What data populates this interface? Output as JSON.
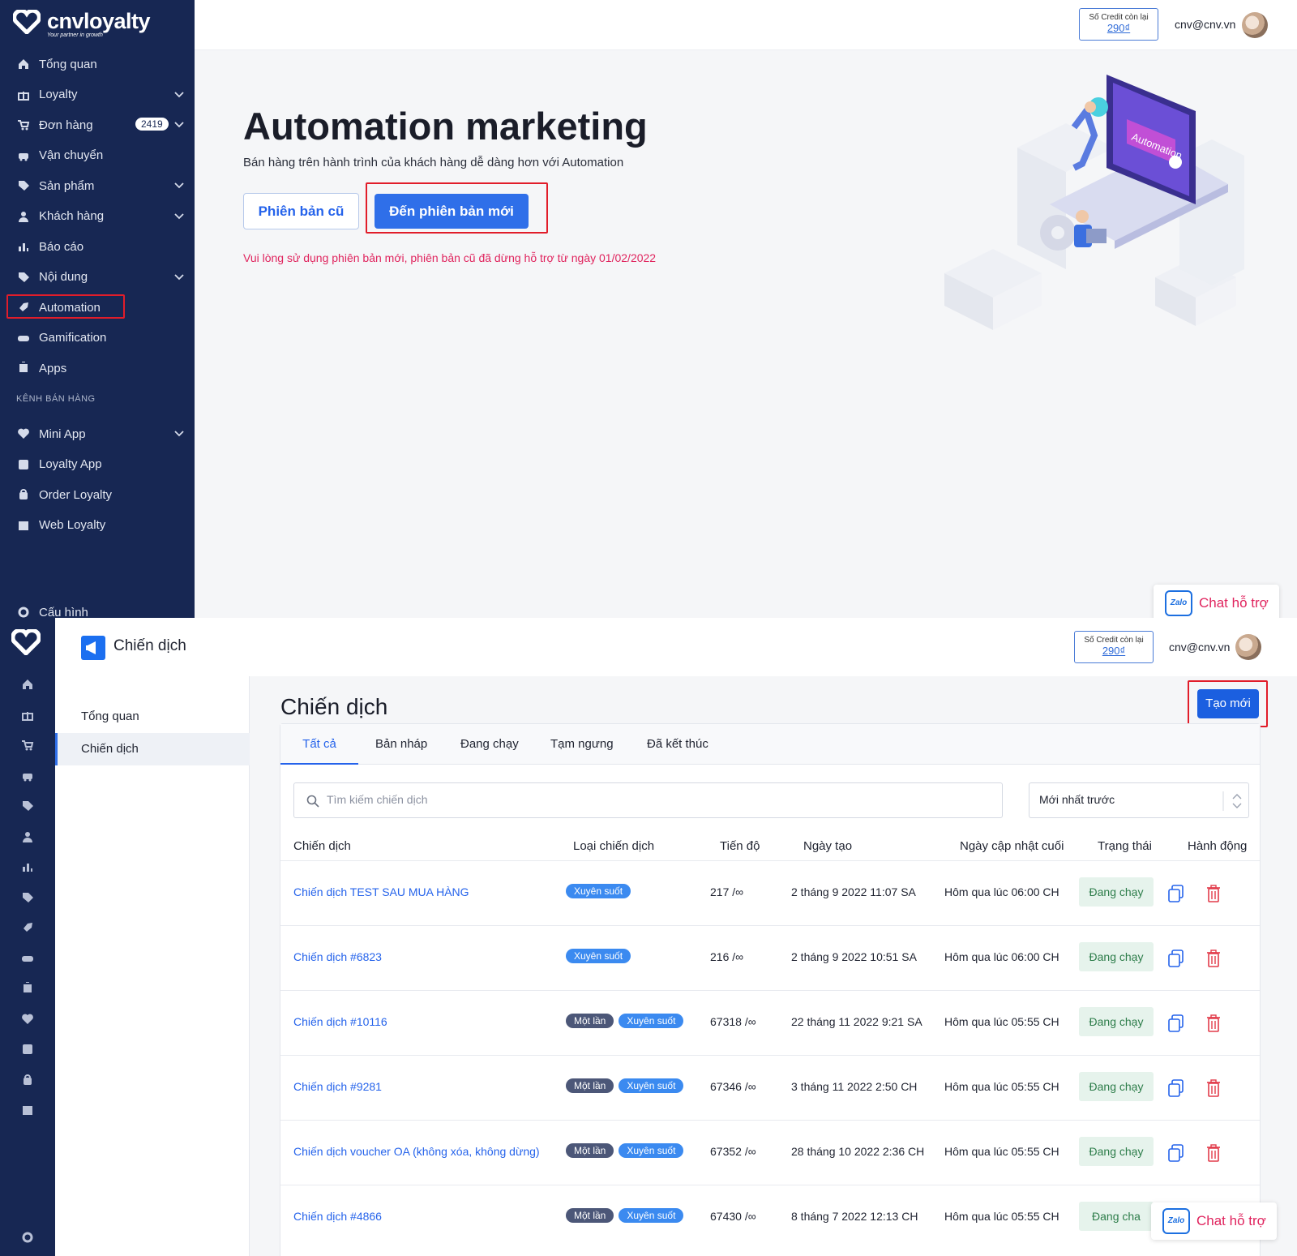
{
  "colors": {
    "sidebar": "#172753",
    "primary": "#2f6fe9",
    "highlight_box": "#e11d2a",
    "warning": "#e0245e"
  },
  "top": {
    "brand": "cnvloyalty",
    "tagline": "Your partner in growth",
    "nav": [
      {
        "label": "Tổng quan",
        "icon": "home-icon"
      },
      {
        "label": "Loyalty",
        "icon": "gift-icon"
      },
      {
        "label": "Đơn hàng",
        "icon": "cart-icon",
        "badge": "2419"
      },
      {
        "label": "Vận chuyển",
        "icon": "car-icon"
      },
      {
        "label": "Sản phẩm",
        "icon": "tag-icon"
      },
      {
        "label": "Khách hàng",
        "icon": "user-icon"
      },
      {
        "label": "Báo cáo",
        "icon": "chart-icon"
      },
      {
        "label": "Nội dung",
        "icon": "tag-icon"
      },
      {
        "label": "Automation",
        "icon": "rocket-icon"
      },
      {
        "label": "Gamification",
        "icon": "gamepad-icon"
      },
      {
        "label": "Apps",
        "icon": "puzzle-icon"
      }
    ],
    "section_label": "KÊNH BÁN HÀNG",
    "channels": [
      {
        "label": "Mini App",
        "icon": "heart-icon"
      },
      {
        "label": "Loyalty App",
        "icon": "app-store-icon"
      },
      {
        "label": "Order Loyalty",
        "icon": "bag-icon"
      },
      {
        "label": "Web Loyalty",
        "icon": "store-icon"
      }
    ],
    "settings": "Cấu hình",
    "credit_label": "Số Credit còn lại",
    "credit_value": "290₫",
    "email": "cnv@cnv.vn",
    "title": "Automation marketing",
    "subtitle": "Bán hàng trên hành trình của khách hàng dễ dàng hơn với Automation",
    "old_version_btn": "Phiên bản cũ",
    "new_version_btn": "Đến phiên bản mới",
    "warning": "Vui lòng sử dụng phiên bản mới, phiên bản cũ đã dừng hỗ trợ từ ngày 01/02/2022",
    "illustration_text": "Automation",
    "chat_label": "Chat hỗ trợ",
    "zalo": "Zalo"
  },
  "bottom": {
    "header_title": "Chiến dịch",
    "credit_label": "Số Credit còn lại",
    "credit_value": "290₫",
    "email": "cnv@cnv.vn",
    "left_menu": [
      "Tổng quan",
      "Chiến dịch"
    ],
    "page_title": "Chiến dịch",
    "create_btn": "Tạo mới",
    "tabs": [
      "Tất cả",
      "Bản nháp",
      "Đang chạy",
      "Tạm ngưng",
      "Đã kết thúc"
    ],
    "search_placeholder": "Tìm kiếm chiến dịch",
    "sort_value": "Mới nhất trước",
    "columns": [
      "Chiến dịch",
      "Loại chiến dịch",
      "Tiến độ",
      "Ngày tạo",
      "Ngày cập nhật cuối",
      "Trạng thái",
      "Hành động"
    ],
    "rows": [
      {
        "name": "Chiến dịch TEST SAU MUA HÀNG",
        "types": [
          "Xuyên suốt"
        ],
        "progress": "217 /∞",
        "created": "2 tháng 9 2022 11:07 SA",
        "updated": "Hôm qua lúc 06:00 CH",
        "status": "Đang chạy"
      },
      {
        "name": "Chiến dịch #6823",
        "types": [
          "Xuyên suốt"
        ],
        "progress": "216 /∞",
        "created": "2 tháng 9 2022 10:51 SA",
        "updated": "Hôm qua lúc 06:00 CH",
        "status": "Đang chạy"
      },
      {
        "name": "Chiến dịch #10116",
        "types": [
          "Một lần",
          "Xuyên suốt"
        ],
        "progress": "67318 /∞",
        "created": "22 tháng 11 2022 9:21 SA",
        "updated": "Hôm qua lúc 05:55 CH",
        "status": "Đang chạy"
      },
      {
        "name": "Chiến dịch #9281",
        "types": [
          "Một lần",
          "Xuyên suốt"
        ],
        "progress": "67346 /∞",
        "created": "3 tháng 11 2022 2:50 CH",
        "updated": "Hôm qua lúc 05:55 CH",
        "status": "Đang chạy"
      },
      {
        "name": "Chiến dịch voucher OA (không xóa, không dừng)",
        "types": [
          "Một lần",
          "Xuyên suốt"
        ],
        "progress": "67352 /∞",
        "created": "28 tháng 10 2022 2:36 CH",
        "updated": "Hôm qua lúc 05:55 CH",
        "status": "Đang chạy"
      },
      {
        "name": "Chiến dịch #4866",
        "types": [
          "Một lần",
          "Xuyên suốt"
        ],
        "progress": "67430 /∞",
        "created": "8 tháng 7 2022 12:13 CH",
        "updated": "Hôm qua lúc 05:55 CH",
        "status": "Đang cha"
      }
    ],
    "chat_label": "Chat hỗ trợ",
    "zalo": "Zalo"
  }
}
